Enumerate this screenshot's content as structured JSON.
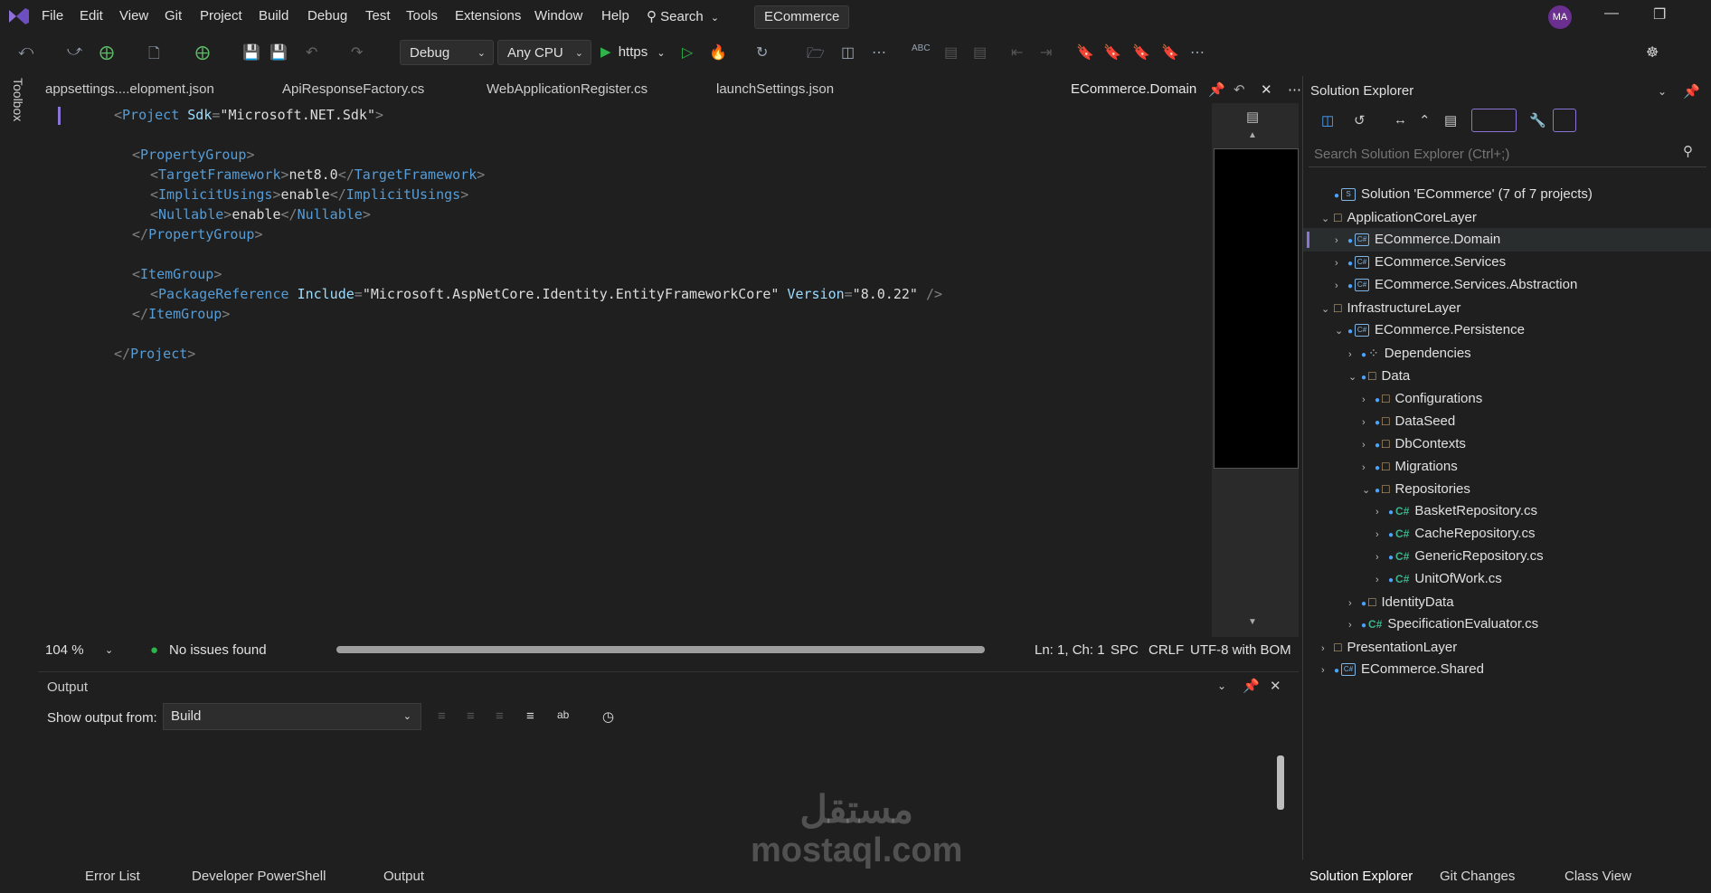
{
  "menu": {
    "items": [
      "File",
      "Edit",
      "View",
      "Git",
      "Project",
      "Build",
      "Debug",
      "Test",
      "Tools",
      "Extensions",
      "Window",
      "Help"
    ],
    "search_label": "Search",
    "solution_name": "ECommerce",
    "avatar_initials": "MA"
  },
  "toolbar": {
    "config": "Debug",
    "platform": "Any CPU",
    "run_target": "https"
  },
  "toolbox_label": "Toolbox",
  "tabs": [
    {
      "label": "appsettings....elopment.json"
    },
    {
      "label": "ApiResponseFactory.cs"
    },
    {
      "label": "WebApplicationRegister.cs"
    },
    {
      "label": "launchSettings.json"
    }
  ],
  "active_tab": {
    "label": "ECommerce.Domain"
  },
  "code_lines": [
    "<Project Sdk=\"Microsoft.NET.Sdk\">",
    "",
    "  <PropertyGroup>",
    "    <TargetFramework>net8.0</TargetFramework>",
    "    <ImplicitUsings>enable</ImplicitUsings>",
    "    <Nullable>enable</Nullable>",
    "  </PropertyGroup>",
    "",
    "  <ItemGroup>",
    "    <PackageReference Include=\"Microsoft.AspNetCore.Identity.EntityFrameworkCore\" Version=\"8.0.22\" />",
    "  </ItemGroup>",
    "",
    "</Project>"
  ],
  "status": {
    "zoom": "104 %",
    "issues": "No issues found",
    "position": "Ln: 1, Ch: 1",
    "whitespace": "SPC",
    "line_ending": "CRLF",
    "encoding": "UTF-8 with BOM"
  },
  "output": {
    "title": "Output",
    "show_from_label": "Show output from:",
    "source": "Build"
  },
  "bottom_tabs": [
    "Error List",
    "Developer PowerShell",
    "Output"
  ],
  "solution_explorer": {
    "title": "Solution Explorer",
    "search_placeholder": "Search Solution Explorer (Ctrl+;)",
    "tree": [
      {
        "label": "Solution 'ECommerce' (7 of 7 projects)",
        "kind": "solution",
        "depth": 0,
        "expand": ""
      },
      {
        "label": "ApplicationCoreLayer",
        "kind": "folder",
        "depth": 0,
        "expand": "open"
      },
      {
        "label": "ECommerce.Domain",
        "kind": "project",
        "depth": 1,
        "expand": "closed",
        "selected": true
      },
      {
        "label": "ECommerce.Services",
        "kind": "project",
        "depth": 1,
        "expand": "closed"
      },
      {
        "label": "ECommerce.Services.Abstraction",
        "kind": "project",
        "depth": 1,
        "expand": "closed"
      },
      {
        "label": "InfrastructureLayer",
        "kind": "folder",
        "depth": 0,
        "expand": "open"
      },
      {
        "label": "ECommerce.Persistence",
        "kind": "project",
        "depth": 1,
        "expand": "open"
      },
      {
        "label": "Dependencies",
        "kind": "deps",
        "depth": 2,
        "expand": "closed"
      },
      {
        "label": "Data",
        "kind": "folder-lock",
        "depth": 2,
        "expand": "open"
      },
      {
        "label": "Configurations",
        "kind": "folder-lock",
        "depth": 3,
        "expand": "closed"
      },
      {
        "label": "DataSeed",
        "kind": "folder-lock",
        "depth": 3,
        "expand": "closed"
      },
      {
        "label": "DbContexts",
        "kind": "folder-lock",
        "depth": 3,
        "expand": "closed"
      },
      {
        "label": "Migrations",
        "kind": "folder-lock",
        "depth": 3,
        "expand": "closed"
      },
      {
        "label": "Repositories",
        "kind": "folder-lock",
        "depth": 3,
        "expand": "open"
      },
      {
        "label": "BasketRepository.cs",
        "kind": "cs",
        "depth": 4,
        "expand": "closed"
      },
      {
        "label": "CacheRepository.cs",
        "kind": "cs",
        "depth": 4,
        "expand": "closed"
      },
      {
        "label": "GenericRepository.cs",
        "kind": "cs",
        "depth": 4,
        "expand": "closed"
      },
      {
        "label": "UnitOfWork.cs",
        "kind": "cs",
        "depth": 4,
        "expand": "closed"
      },
      {
        "label": "IdentityData",
        "kind": "folder-lock",
        "depth": 2,
        "expand": "closed"
      },
      {
        "label": "SpecificationEvaluator.cs",
        "kind": "cs",
        "depth": 2,
        "expand": "closed"
      },
      {
        "label": "PresentationLayer",
        "kind": "folder",
        "depth": 0,
        "expand": "closed"
      },
      {
        "label": "ECommerce.Shared",
        "kind": "project",
        "depth": 0,
        "expand": "closed"
      }
    ],
    "bottom_tabs": [
      "Solution Explorer",
      "Git Changes",
      "Class View"
    ]
  },
  "watermark": {
    "line1": "مستقل",
    "line2": "mostaql.com"
  }
}
